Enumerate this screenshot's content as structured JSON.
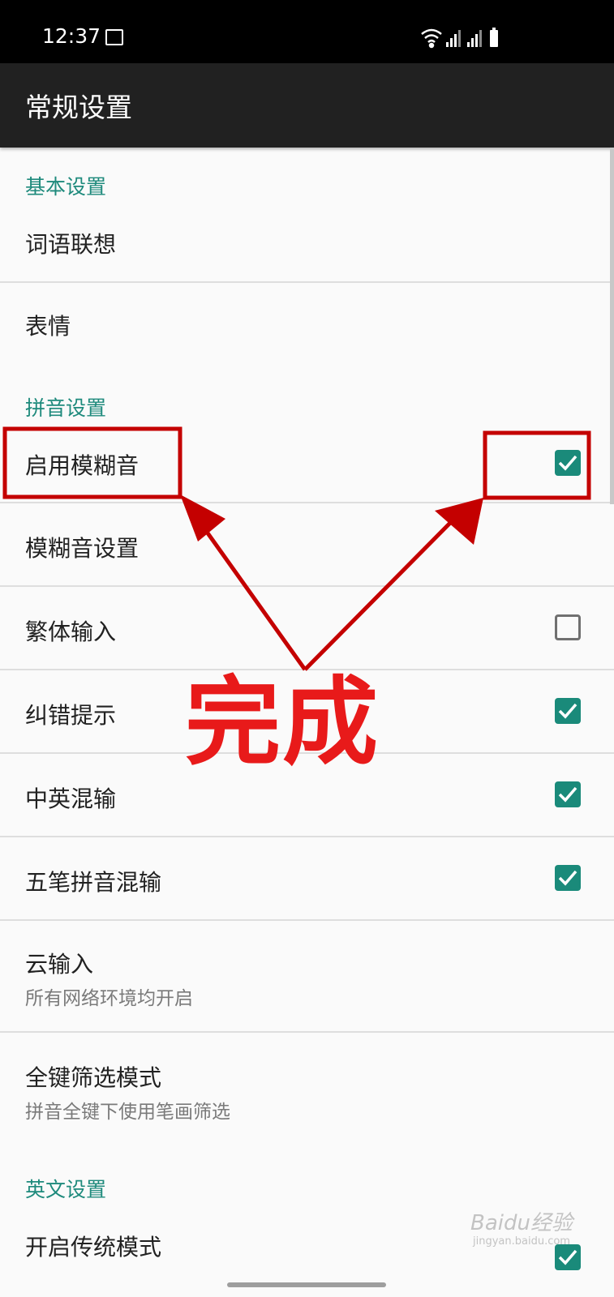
{
  "status_bar": {
    "time": "12:37"
  },
  "app_bar": {
    "title": "常规设置"
  },
  "sections": {
    "basic": "基本设置",
    "pinyin": "拼音设置",
    "english": "英文设置"
  },
  "rows": {
    "word_association": {
      "title": "词语联想"
    },
    "emoji": {
      "title": "表情"
    },
    "fuzzy_enable": {
      "title": "启用模糊音",
      "checked": true
    },
    "fuzzy_settings": {
      "title": "模糊音设置"
    },
    "traditional": {
      "title": "繁体输入",
      "checked": false
    },
    "error_hint": {
      "title": "纠错提示",
      "checked": true
    },
    "cn_en_mix": {
      "title": "中英混输",
      "checked": true
    },
    "wubi_pinyin_mix": {
      "title": "五笔拼音混输",
      "checked": true
    },
    "cloud_input": {
      "title": "云输入",
      "subtitle": "所有网络环境均开启"
    },
    "full_key_filter": {
      "title": "全键筛选模式",
      "subtitle": "拼音全键下使用笔画筛选"
    },
    "traditional_mode": {
      "title": "开启传统模式",
      "checked": true
    }
  },
  "annotation": {
    "text": "完成",
    "color": "#e81a1a"
  },
  "watermark": {
    "text": "Baidu经验",
    "sub": "jingyan.baidu.com"
  },
  "colors": {
    "accent": "#1a8a7a",
    "app_bar": "#212121",
    "annotation": "#c40000"
  }
}
